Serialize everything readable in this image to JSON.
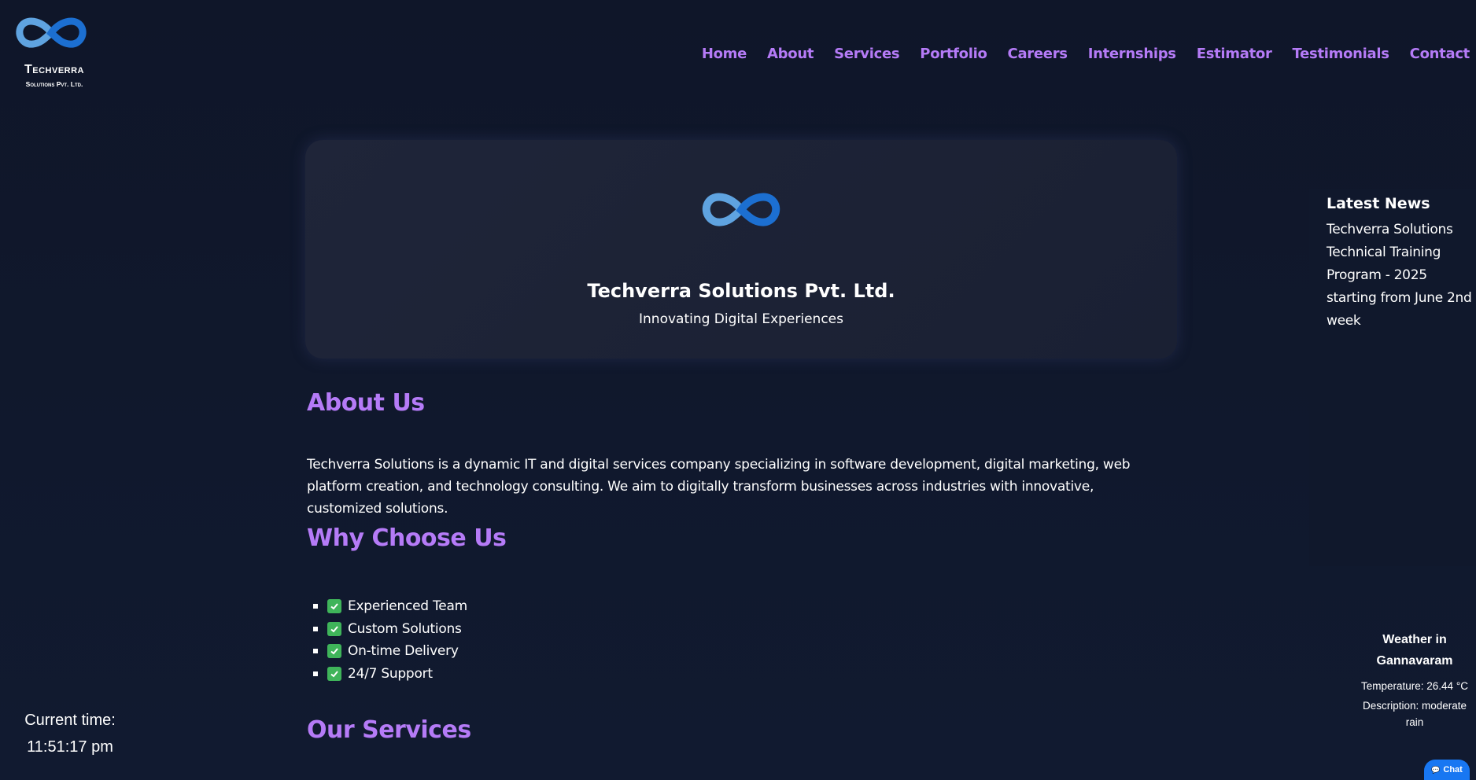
{
  "brand": {
    "name": "Techverra",
    "subtitle": "Solutions Pvt. Ltd.",
    "colors": {
      "accent": "#b57bf7",
      "logo_light": "#5fa3e0",
      "logo_dark": "#1c6fd1"
    }
  },
  "nav": {
    "items": [
      "Home",
      "About",
      "Services",
      "Portfolio",
      "Careers",
      "Internships",
      "Estimator",
      "Testimonials",
      "Contact"
    ]
  },
  "hero": {
    "icon": "infinity-logo-icon",
    "title": "Techverra Solutions Pvt. Ltd.",
    "subtitle": "Innovating Digital Experiences"
  },
  "about": {
    "title": "About Us",
    "text": "Techverra Solutions is a dynamic IT and digital services company specializing in software development, digital marketing, web platform creation, and technology consulting. We aim to digitally transform businesses across industries with innovative, customized solutions."
  },
  "why": {
    "title": "Why Choose Us",
    "items": [
      "Experienced Team",
      "Custom Solutions",
      "On-time Delivery",
      "24/7 Support"
    ]
  },
  "services": {
    "title": "Our Services"
  },
  "news": {
    "title": "Latest News",
    "body": "Techverra Solutions Technical Training Program - 2025 starting from June 2nd week"
  },
  "weather": {
    "title": "Weather in Gannavaram",
    "temperature": "Temperature: 26.44 °C",
    "description": "Description: moderate rain"
  },
  "clock": {
    "label": "Current time:",
    "value": "11:51:17 pm"
  },
  "chat": {
    "label": "Chat",
    "icon": "chat-bubble-icon"
  }
}
